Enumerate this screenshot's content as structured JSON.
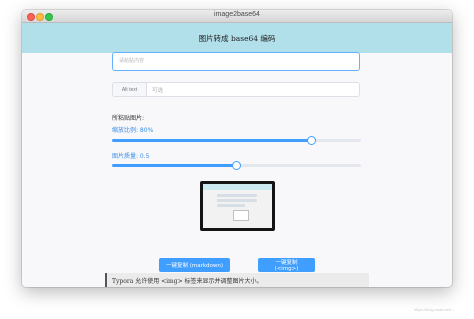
{
  "window": {
    "title": "image2base64"
  },
  "header": {
    "title": "图片转成 base64 编码"
  },
  "paste_area": {
    "placeholder": "请粘贴内容"
  },
  "alt_text": {
    "label": "Alt text",
    "placeholder": "可选"
  },
  "pasted_image": {
    "label": "所粘贴图片:",
    "scale_label": "缩放比例: 80%",
    "scale_value": 0.8,
    "quality_label": "图片质量: 0.5",
    "quality_value": 0.5
  },
  "buttons": {
    "copy_markdown": "一键复制 (markdown)",
    "copy_img": "一键复制 (<img>)"
  },
  "notice": {
    "text": "Typora 允许使用 <img> 标签来显示并调整图片大小。"
  },
  "watermark": {
    "text": "https://blog.csdn.net/..."
  },
  "colors": {
    "accent": "#409eff",
    "header_bg": "#b1dfea"
  }
}
